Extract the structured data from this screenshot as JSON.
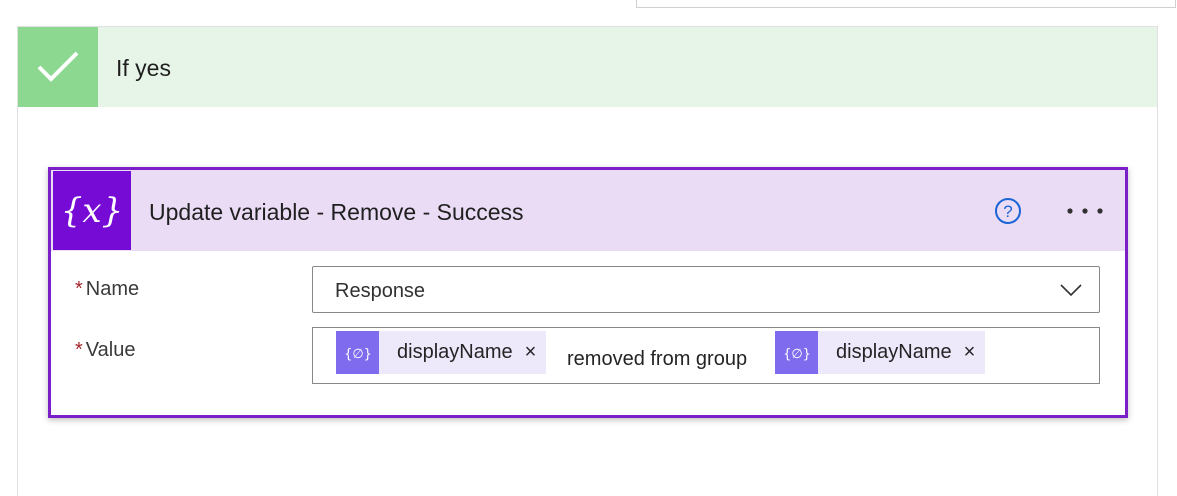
{
  "branch": {
    "title": "If yes",
    "icon": "checkmark-icon"
  },
  "card": {
    "title": "Update variable - Remove - Success",
    "icon": "variable-icon",
    "icon_glyph": "{x}",
    "help_icon": "help-circle-icon",
    "more_icon": "ellipsis-icon",
    "accent_color": "#770bd6",
    "fields": {
      "name": {
        "required_mark": "*",
        "label": "Name",
        "selected_value": "Response"
      },
      "value": {
        "required_mark": "*",
        "label": "Value",
        "tokens": [
          {
            "label": "displayName",
            "remove": "×"
          },
          {
            "label": "displayName",
            "remove": "×"
          }
        ],
        "text": "removed from group"
      }
    }
  },
  "colors": {
    "branch_header_bg": "#e7f5e8",
    "check_bg": "#8cd891",
    "card_header_bg": "#ebdcf6",
    "token_bg": "#eee8fb",
    "token_icon_bg": "#7e6bee"
  }
}
